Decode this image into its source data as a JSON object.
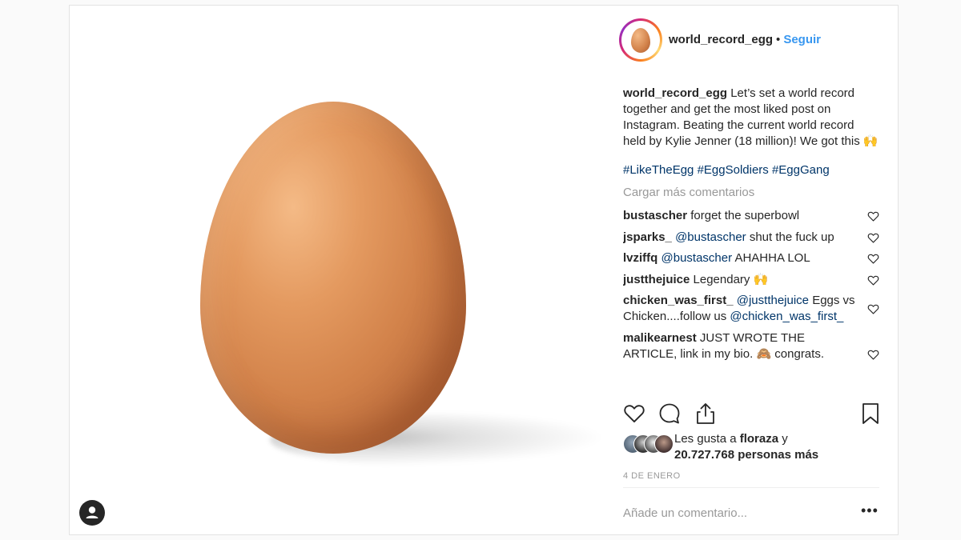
{
  "post": {
    "author": "world_record_egg",
    "separator": "•",
    "follow_label": "Seguir",
    "caption": "Let’s set a world record together and get the most liked post on Instagram. Beating the current world record held by Kylie Jenner (18 million)! We got this 🙌",
    "hashtags": "#LikeTheEgg #EggSoldiers #EggGang",
    "load_more": "Cargar más comentarios",
    "comments": [
      {
        "user": "bustascher",
        "mention": "",
        "text": "forget the superbowl"
      },
      {
        "user": "jsparks_",
        "mention": "@bustascher",
        "text": "shut the fuck up"
      },
      {
        "user": "lvziffq",
        "mention": "@bustascher",
        "text": "AHAHHA LOL"
      },
      {
        "user": "justthejuice",
        "mention": "",
        "text": "Legendary 🙌"
      },
      {
        "user": "chicken_was_first_",
        "mention": "@justthejuice",
        "text": "Eggs vs Chicken....follow us",
        "mention2": "@chicken_was_first_"
      },
      {
        "user": "malikearnest",
        "mention": "",
        "text": "JUST WROTE THE ARTICLE, link in my bio. 🙈 congrats."
      }
    ],
    "likes": {
      "prefix": "Les gusta a",
      "user": "floraza",
      "joiner": "y",
      "count_text": "20.727.768 personas más"
    },
    "date": "4 DE ENERO",
    "add_comment_placeholder": "Añade un comentario...",
    "more_options": "•••"
  },
  "icons": {
    "like": "heart-icon",
    "comment": "comment-icon",
    "share": "share-icon",
    "save": "bookmark-icon",
    "comment_like": "heart-icon",
    "user_tag": "user-icon"
  },
  "colors": {
    "accent": "#3897f0",
    "hashtag": "#003569",
    "muted": "#999999",
    "text": "#262626"
  }
}
